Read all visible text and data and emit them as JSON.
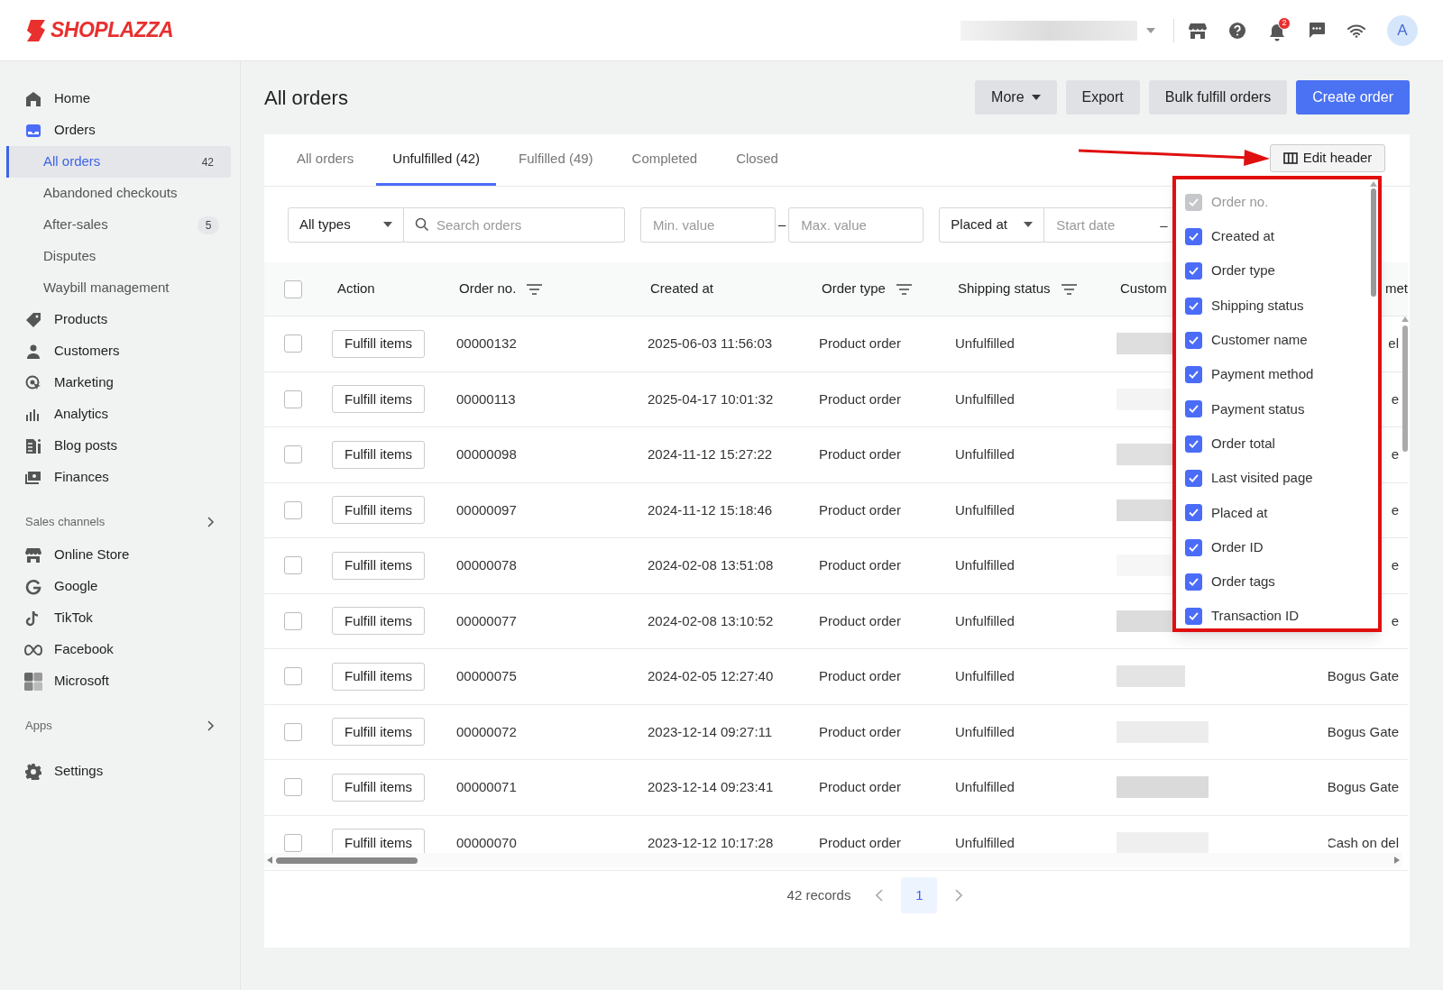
{
  "header": {
    "logo": "SHOPLAZZA",
    "notification_count": "2",
    "avatar": "A"
  },
  "sidebar": [
    {
      "kind": "item",
      "label": "Home"
    },
    {
      "kind": "item",
      "label": "Orders"
    },
    {
      "kind": "subitem",
      "label": "All orders",
      "badge": "42",
      "selected": true
    },
    {
      "kind": "subitem",
      "label": "Abandoned checkouts",
      "selected": false
    },
    {
      "kind": "subitem",
      "label": "After-sales",
      "badge": "5",
      "selected": false
    },
    {
      "kind": "subitem",
      "label": "Disputes",
      "selected": false
    },
    {
      "kind": "subitem",
      "label": "Waybill management",
      "selected": false
    },
    {
      "kind": "item",
      "label": "Products"
    },
    {
      "kind": "item",
      "label": "Customers"
    },
    {
      "kind": "item",
      "label": "Marketing"
    },
    {
      "kind": "item",
      "label": "Analytics"
    },
    {
      "kind": "item",
      "label": "Blog posts"
    },
    {
      "kind": "item",
      "label": "Finances"
    },
    {
      "kind": "section",
      "label": "Sales channels"
    },
    {
      "kind": "item",
      "label": "Online Store"
    },
    {
      "kind": "item",
      "label": "Google"
    },
    {
      "kind": "item",
      "label": "TikTok"
    },
    {
      "kind": "item",
      "label": "Facebook"
    },
    {
      "kind": "item",
      "label": "Microsoft"
    },
    {
      "kind": "section",
      "label": "Apps"
    },
    {
      "kind": "item",
      "label": "Settings"
    }
  ],
  "page": {
    "title": "All orders",
    "actions": [
      {
        "label": "More",
        "kind": "dropdown"
      },
      {
        "label": "Export",
        "kind": "secondary"
      },
      {
        "label": "Bulk fulfill orders",
        "kind": "secondary"
      },
      {
        "label": "Create order",
        "kind": "primary"
      }
    ]
  },
  "tabs": [
    {
      "label": "All orders",
      "selected": false
    },
    {
      "label": "Unfulfilled (42)",
      "selected": true
    },
    {
      "label": "Fulfilled (49)",
      "selected": false
    },
    {
      "label": "Completed",
      "selected": false
    },
    {
      "label": "Closed",
      "selected": false
    }
  ],
  "edit_header_button": "Edit header",
  "filters": {
    "type_select": "All types",
    "search_placeholder": "Search orders",
    "min_placeholder": "Min. value",
    "range_separator": "–",
    "max_placeholder": "Max. value",
    "date_select": "Placed at",
    "start_date_placeholder": "Start date",
    "date_separator": "–"
  },
  "table": {
    "select_all_checked": false,
    "columns": [
      {
        "label": "Action",
        "filter": false
      },
      {
        "label": "Order no.",
        "filter": true
      },
      {
        "label": "Created at",
        "filter": false
      },
      {
        "label": "Order type",
        "filter": true
      },
      {
        "label": "Shipping status",
        "filter": true
      },
      {
        "label": "Custom",
        "filter": false
      },
      {
        "label": "met",
        "filter": false
      }
    ],
    "rows": [
      {
        "checked": false,
        "action": "Fulfill items",
        "order_no": "00000132",
        "created_at": "2025-06-03 11:56:03",
        "order_type": "Product order",
        "shipping_status": "Unfulfilled",
        "payment": "el"
      },
      {
        "checked": false,
        "action": "Fulfill items",
        "order_no": "00000113",
        "created_at": "2025-04-17 10:01:32",
        "order_type": "Product order",
        "shipping_status": "Unfulfilled",
        "payment": "e"
      },
      {
        "checked": false,
        "action": "Fulfill items",
        "order_no": "00000098",
        "created_at": "2024-11-12 15:27:22",
        "order_type": "Product order",
        "shipping_status": "Unfulfilled",
        "payment": "e"
      },
      {
        "checked": false,
        "action": "Fulfill items",
        "order_no": "00000097",
        "created_at": "2024-11-12 15:18:46",
        "order_type": "Product order",
        "shipping_status": "Unfulfilled",
        "payment": "e"
      },
      {
        "checked": false,
        "action": "Fulfill items",
        "order_no": "00000078",
        "created_at": "2024-02-08 13:51:08",
        "order_type": "Product order",
        "shipping_status": "Unfulfilled",
        "payment": "e"
      },
      {
        "checked": false,
        "action": "Fulfill items",
        "order_no": "00000077",
        "created_at": "2024-02-08 13:10:52",
        "order_type": "Product order",
        "shipping_status": "Unfulfilled",
        "payment": "e"
      },
      {
        "checked": false,
        "action": "Fulfill items",
        "order_no": "00000075",
        "created_at": "2024-02-05 12:27:40",
        "order_type": "Product order",
        "shipping_status": "Unfulfilled",
        "payment": "Bogus Gate"
      },
      {
        "checked": false,
        "action": "Fulfill items",
        "order_no": "00000072",
        "created_at": "2023-12-14 09:27:11",
        "order_type": "Product order",
        "shipping_status": "Unfulfilled",
        "payment": "Bogus Gate"
      },
      {
        "checked": false,
        "action": "Fulfill items",
        "order_no": "00000071",
        "created_at": "2023-12-14 09:23:41",
        "order_type": "Product order",
        "shipping_status": "Unfulfilled",
        "payment": "Bogus Gate"
      },
      {
        "checked": false,
        "action": "Fulfill items",
        "order_no": "00000070",
        "created_at": "2023-12-12 10:17:28",
        "order_type": "Product order",
        "shipping_status": "Unfulfilled",
        "payment": "Cash on del"
      }
    ]
  },
  "column_menu": [
    {
      "label": "Order no.",
      "checked": true,
      "disabled": true
    },
    {
      "label": "Created at",
      "checked": true,
      "disabled": false
    },
    {
      "label": "Order type",
      "checked": true,
      "disabled": false
    },
    {
      "label": "Shipping status",
      "checked": true,
      "disabled": false
    },
    {
      "label": "Customer name",
      "checked": true,
      "disabled": false
    },
    {
      "label": "Payment method",
      "checked": true,
      "disabled": false
    },
    {
      "label": "Payment status",
      "checked": true,
      "disabled": false
    },
    {
      "label": "Order total",
      "checked": true,
      "disabled": false
    },
    {
      "label": "Last visited page",
      "checked": true,
      "disabled": false
    },
    {
      "label": "Placed at",
      "checked": true,
      "disabled": false
    },
    {
      "label": "Order ID",
      "checked": true,
      "disabled": false
    },
    {
      "label": "Order tags",
      "checked": true,
      "disabled": false
    },
    {
      "label": "Transaction ID",
      "checked": true,
      "disabled": false
    }
  ],
  "pagination": {
    "records": "42 records",
    "pages": [
      {
        "label": "1",
        "selected": true
      }
    ]
  }
}
